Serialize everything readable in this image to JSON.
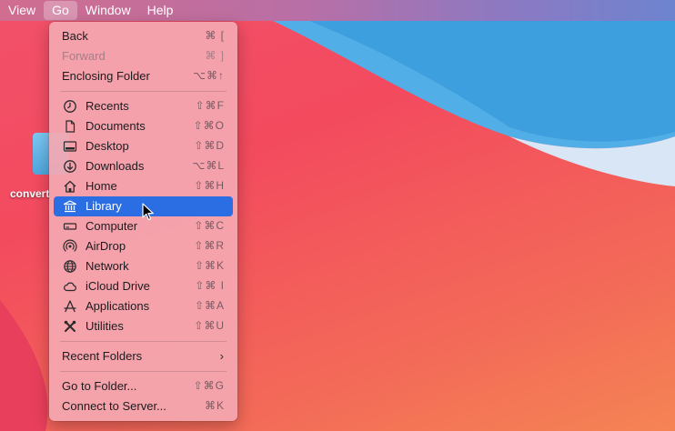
{
  "menubar": {
    "items": [
      "View",
      "Go",
      "Window",
      "Help"
    ],
    "active_index": 1
  },
  "desktop": {
    "icon_label": "convert"
  },
  "menu": {
    "top": [
      {
        "label": "Back",
        "shortcut": "⌘ [",
        "enabled": true
      },
      {
        "label": "Forward",
        "shortcut": "⌘ ]",
        "enabled": false
      },
      {
        "label": "Enclosing Folder",
        "shortcut": "⌥⌘↑",
        "enabled": true
      }
    ],
    "places": [
      {
        "label": "Recents",
        "shortcut": "⇧⌘F",
        "icon": "clock-icon"
      },
      {
        "label": "Documents",
        "shortcut": "⇧⌘O",
        "icon": "document-icon"
      },
      {
        "label": "Desktop",
        "shortcut": "⇧⌘D",
        "icon": "desktop-icon"
      },
      {
        "label": "Downloads",
        "shortcut": "⌥⌘L",
        "icon": "download-icon"
      },
      {
        "label": "Home",
        "shortcut": "⇧⌘H",
        "icon": "home-icon"
      },
      {
        "label": "Library",
        "shortcut": "",
        "icon": "library-icon",
        "highlighted": true
      },
      {
        "label": "Computer",
        "shortcut": "⇧⌘C",
        "icon": "computer-icon"
      },
      {
        "label": "AirDrop",
        "shortcut": "⇧⌘R",
        "icon": "airdrop-icon"
      },
      {
        "label": "Network",
        "shortcut": "⇧⌘K",
        "icon": "network-icon"
      },
      {
        "label": "iCloud Drive",
        "shortcut": "⇧⌘ I",
        "icon": "cloud-icon"
      },
      {
        "label": "Applications",
        "shortcut": "⇧⌘A",
        "icon": "applications-icon"
      },
      {
        "label": "Utilities",
        "shortcut": "⇧⌘U",
        "icon": "utilities-icon"
      }
    ],
    "recent_folders": {
      "label": "Recent Folders",
      "submenu_glyph": "›"
    },
    "bottom": [
      {
        "label": "Go to Folder...",
        "shortcut": "⇧⌘G"
      },
      {
        "label": "Connect to Server...",
        "shortcut": "⌘K"
      }
    ]
  },
  "colors": {
    "highlight": "#2b6de2",
    "wallpaper_blue": "#4aa8e6",
    "wallpaper_red": "#f2516a"
  }
}
